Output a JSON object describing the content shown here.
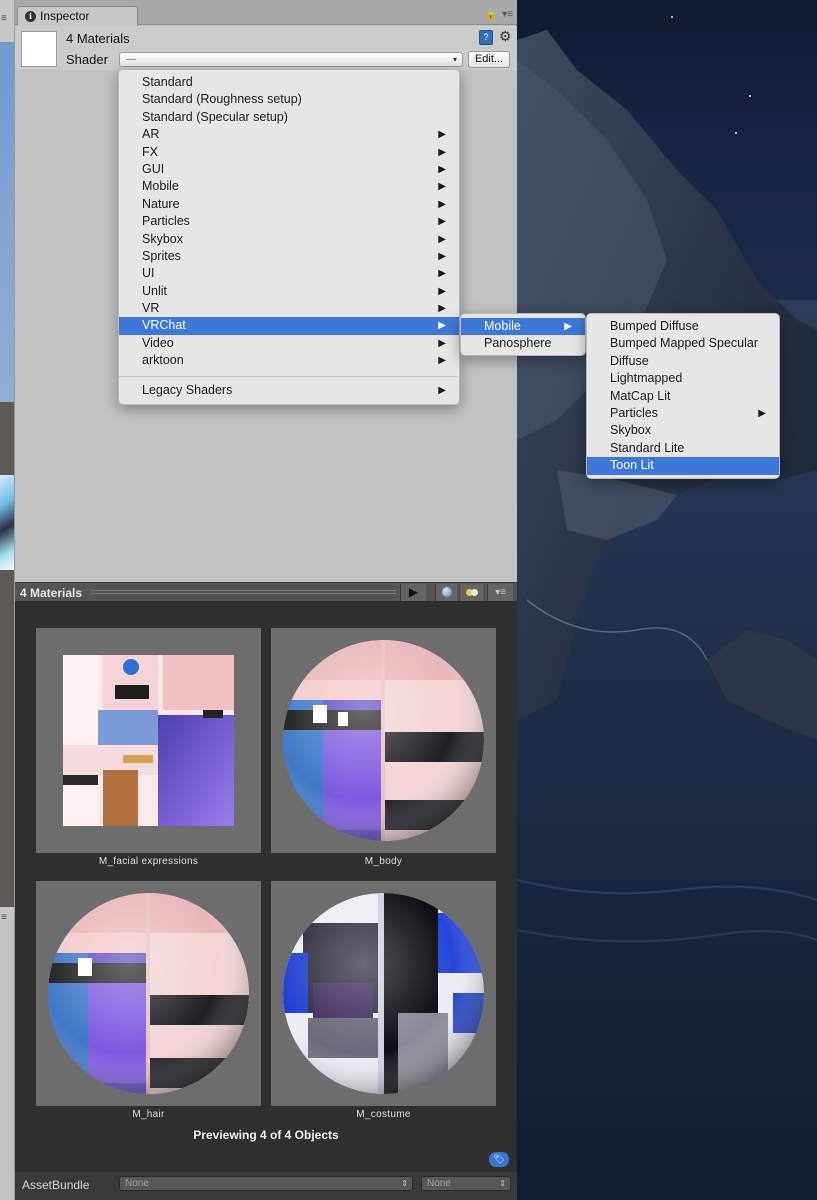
{
  "inspector": {
    "tab_label": "Inspector",
    "tab_tools": [
      "🔒",
      "▾≡"
    ],
    "materials_title": "4 Materials",
    "shader_label": "Shader",
    "shader_value": "—",
    "edit_label": "Edit..."
  },
  "shader_menu": {
    "items": [
      {
        "label": "Standard",
        "submenu": false
      },
      {
        "label": "Standard (Roughness setup)",
        "submenu": false
      },
      {
        "label": "Standard (Specular setup)",
        "submenu": false
      },
      {
        "label": "AR",
        "submenu": true
      },
      {
        "label": "FX",
        "submenu": true
      },
      {
        "label": "GUI",
        "submenu": true
      },
      {
        "label": "Mobile",
        "submenu": true
      },
      {
        "label": "Nature",
        "submenu": true
      },
      {
        "label": "Particles",
        "submenu": true
      },
      {
        "label": "Skybox",
        "submenu": true
      },
      {
        "label": "Sprites",
        "submenu": true
      },
      {
        "label": "UI",
        "submenu": true
      },
      {
        "label": "Unlit",
        "submenu": true
      },
      {
        "label": "VR",
        "submenu": true
      },
      {
        "label": "VRChat",
        "submenu": true,
        "highlighted": true
      },
      {
        "label": "Video",
        "submenu": true
      },
      {
        "label": "arktoon",
        "submenu": true
      }
    ],
    "legacy": {
      "label": "Legacy Shaders",
      "submenu": true
    }
  },
  "vrchat_menu": {
    "items": [
      {
        "label": "Mobile",
        "submenu": true,
        "highlighted": true
      },
      {
        "label": "Panosphere",
        "submenu": false
      }
    ]
  },
  "mobile_menu": {
    "items": [
      {
        "label": "Bumped Diffuse",
        "submenu": false
      },
      {
        "label": "Bumped Mapped Specular",
        "submenu": false
      },
      {
        "label": "Diffuse",
        "submenu": false
      },
      {
        "label": "Lightmapped",
        "submenu": false
      },
      {
        "label": "MatCap Lit",
        "submenu": false
      },
      {
        "label": "Particles",
        "submenu": true
      },
      {
        "label": "Skybox",
        "submenu": false
      },
      {
        "label": "Standard Lite",
        "submenu": false
      },
      {
        "label": "Toon Lit",
        "submenu": false,
        "highlighted": true
      }
    ]
  },
  "preview": {
    "title": "4 Materials",
    "materials": [
      {
        "name": "M_facial expressions",
        "kind": "texture"
      },
      {
        "name": "M_body",
        "kind": "sphere"
      },
      {
        "name": "M_hair",
        "kind": "sphere"
      },
      {
        "name": "M_costume",
        "kind": "sphere-costume"
      }
    ],
    "status": "Previewing 4 of 4 Objects"
  },
  "asset_bundle": {
    "label": "AssetBundle",
    "name_value": "None",
    "variant_value": "None"
  },
  "colors": {
    "highlight": "#3d78d8",
    "menu_bg": "#e6e6e6",
    "preview_bg": "#2f2f2f"
  }
}
